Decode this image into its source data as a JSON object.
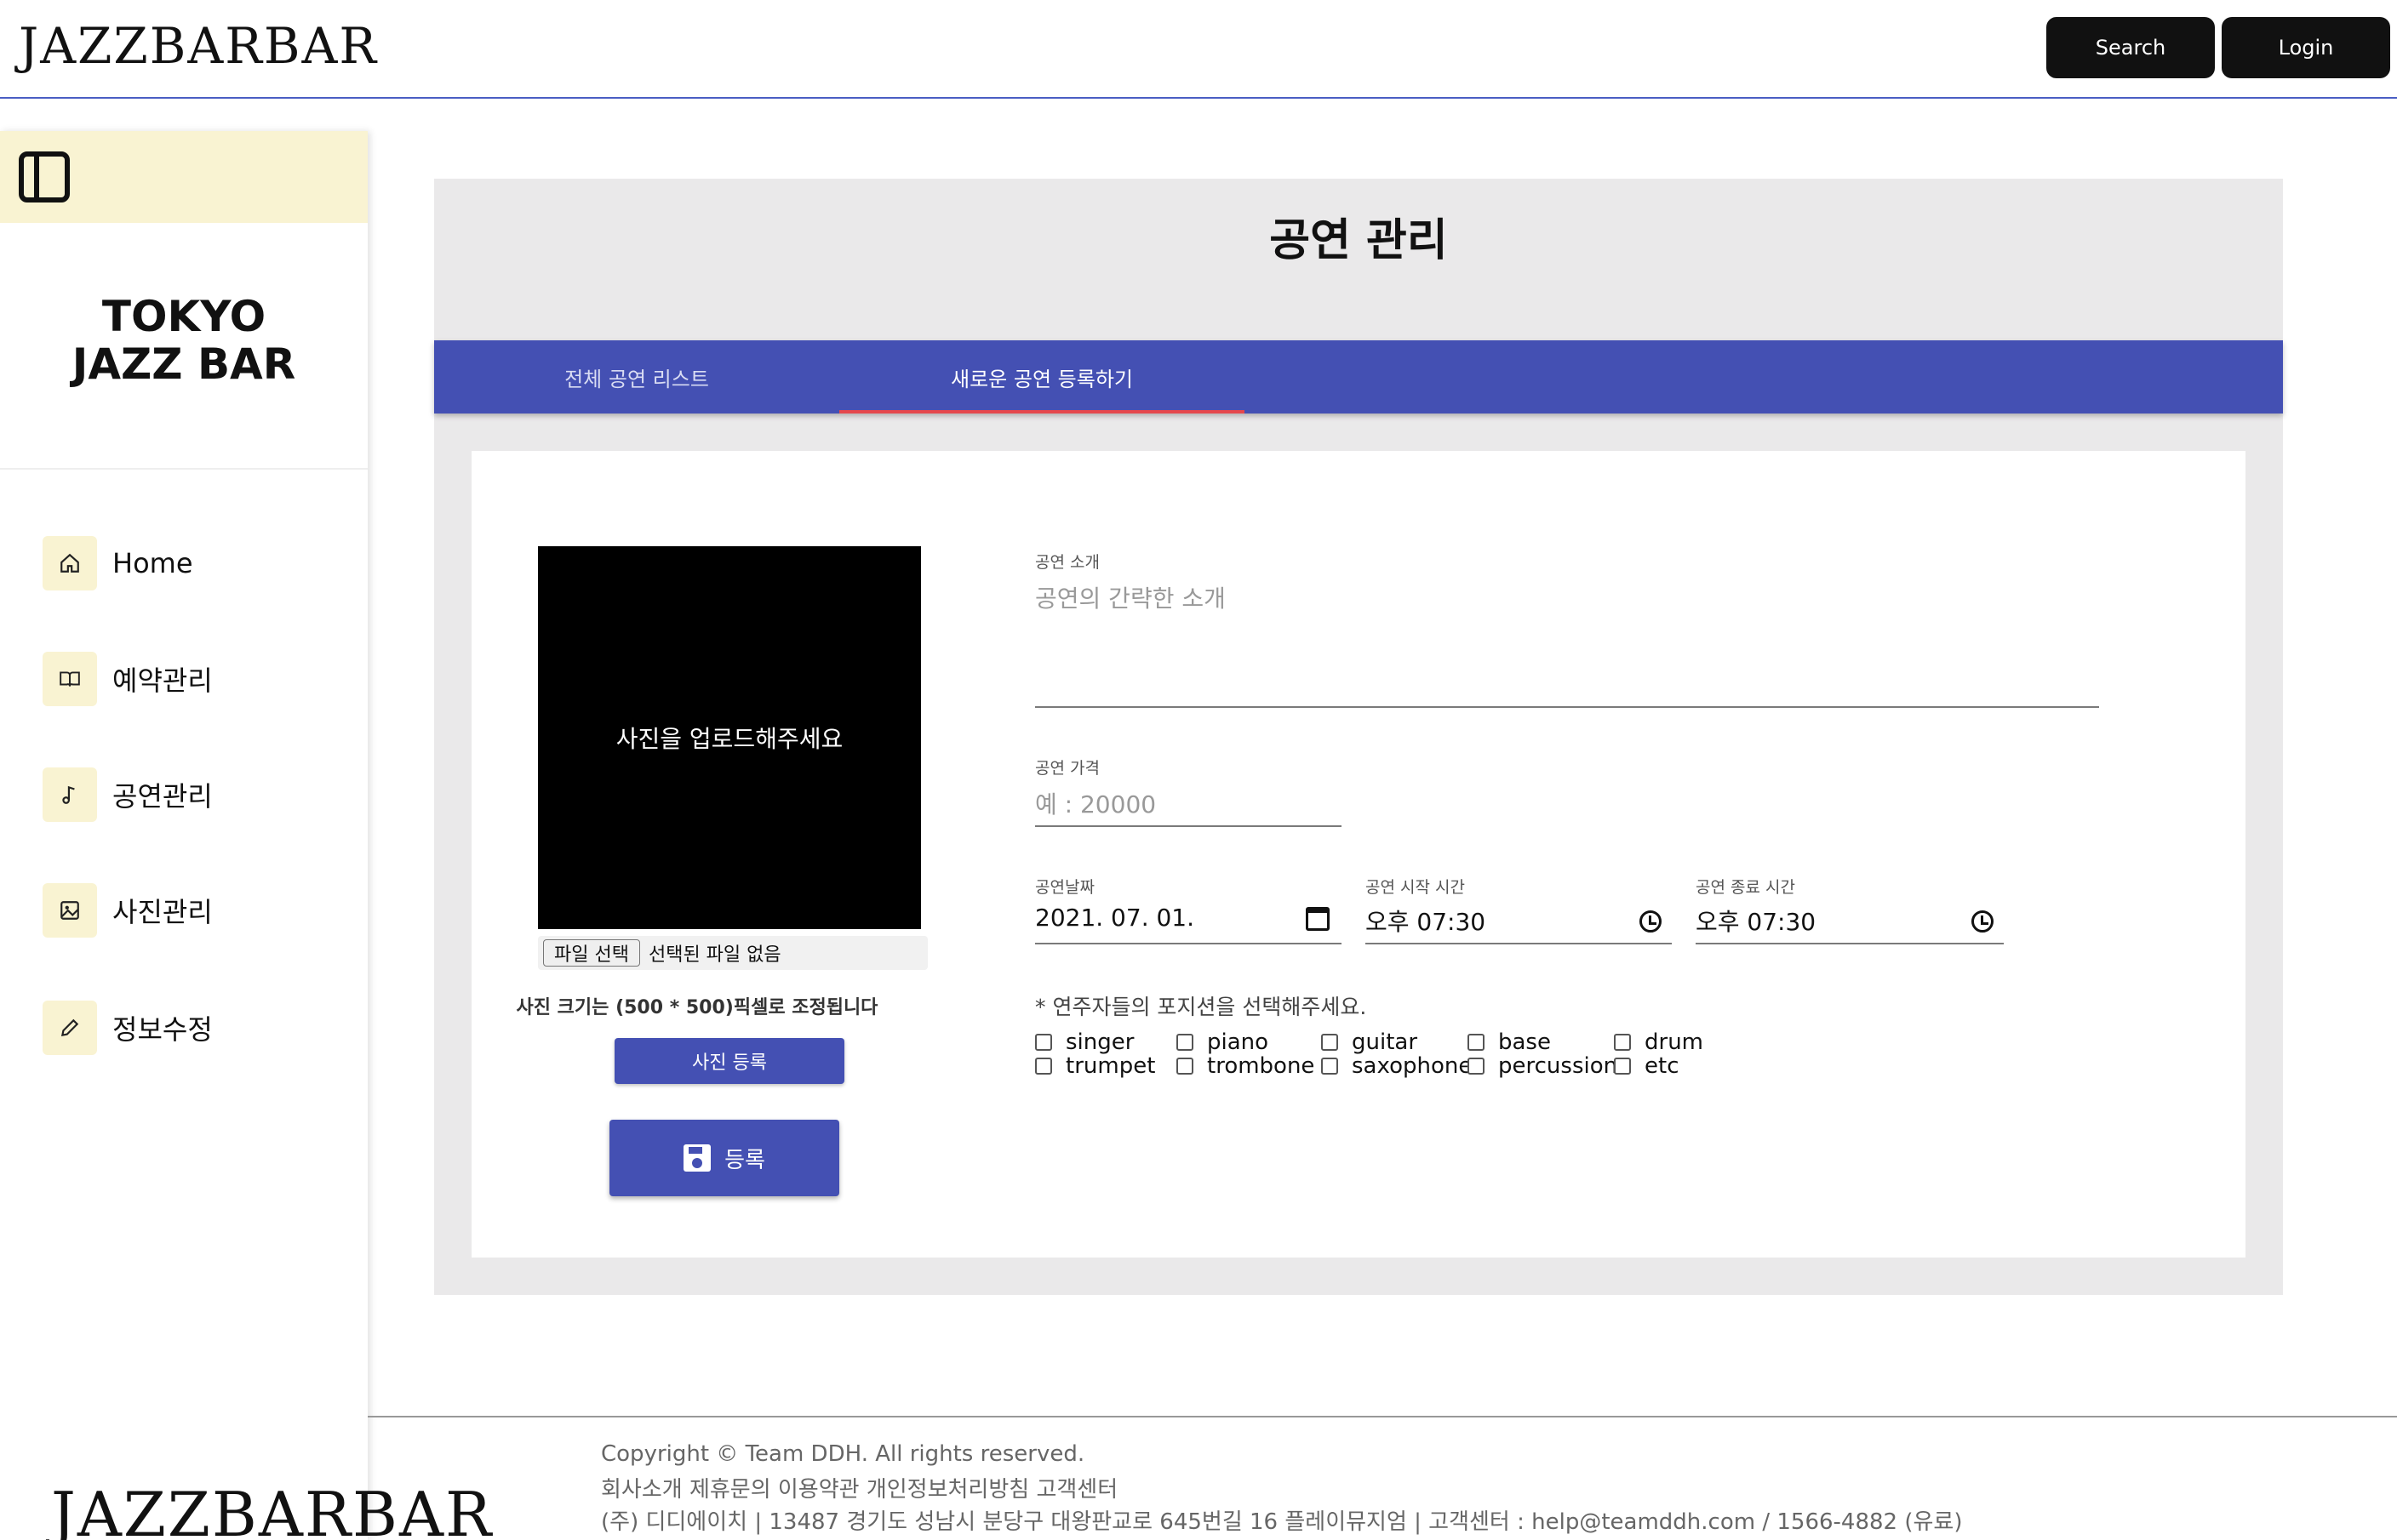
{
  "header": {
    "logo": "JAZZBARBAR",
    "search_label": "Search",
    "login_label": "Login"
  },
  "sidebar": {
    "title_line1": "TOKYO",
    "title_line2": "JAZZ BAR",
    "items": [
      {
        "label": "Home",
        "icon": "home-icon"
      },
      {
        "label": "예약관리",
        "icon": "book-icon"
      },
      {
        "label": "공연관리",
        "icon": "music-note-icon"
      },
      {
        "label": "사진관리",
        "icon": "image-icon"
      },
      {
        "label": "정보수정",
        "icon": "pencil-icon"
      }
    ]
  },
  "main": {
    "title": "공연 관리",
    "tabs": [
      {
        "label": "전체 공연 리스트"
      },
      {
        "label": "새로운 공연 등록하기"
      }
    ],
    "photo": {
      "placeholder": "사진을 업로드해주세요",
      "file_button": "파일 선택",
      "file_status": "선택된 파일 없음",
      "size_note": "사진 크기는 (500 * 500)픽셀로 조정됩니다",
      "upload_button": "사진 등록",
      "register_button": "등록"
    },
    "form": {
      "intro_label": "공연 소개",
      "intro_placeholder": "공연의 간략한 소개",
      "price_label": "공연 가격",
      "price_placeholder": "예 : 20000",
      "date_label": "공연날짜",
      "date_value": "2021. 07. 01.",
      "start_label": "공연 시작 시간",
      "start_value": "오후 07:30",
      "end_label": "공연 종료 시간",
      "end_value": "오후 07:30",
      "positions_note": "* 연주자들의 포지션을 선택해주세요.",
      "positions": [
        "singer",
        "piano",
        "guitar",
        "base",
        "drum",
        "trumpet",
        "trombone",
        "saxophone",
        "percussion",
        "etc"
      ]
    }
  },
  "footer": {
    "logo": "JAZZBARBAR",
    "copyright": "Copyright © Team DDH. All rights reserved.",
    "links": "회사소개 제휴문의 이용약관 개인정보처리방침 고객센터",
    "address": "(주) 디디에이치 | 13487 경기도 성남시 분당구 대왕판교로 645번길 16 플레이뮤지엄 | 고객센터 : help@teamddh.com / 1566-4882 (유료)"
  }
}
